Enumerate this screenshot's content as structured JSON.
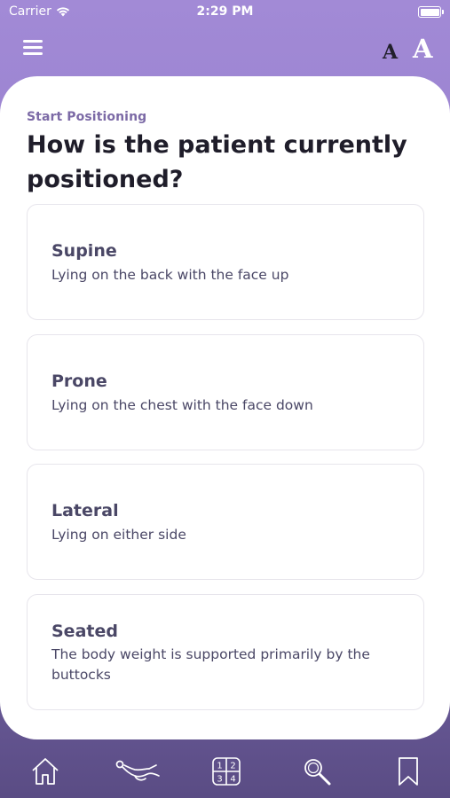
{
  "status_bar": {
    "carrier": "Carrier",
    "time": "2:29 PM"
  },
  "header": {
    "menu_icon": "hamburger-icon",
    "font_small_label": "A",
    "font_large_label": "A"
  },
  "main": {
    "eyebrow": "Start Positioning",
    "question": "How is the patient currently positioned?",
    "options": [
      {
        "title": "Supine",
        "description": "Lying on the back with the face up"
      },
      {
        "title": "Prone",
        "description": "Lying on the chest with the face down"
      },
      {
        "title": "Lateral",
        "description": "Lying on either side"
      },
      {
        "title": "Seated",
        "description": "The body weight is supported primarily by the buttocks"
      }
    ]
  },
  "tabbar": {
    "tabs": [
      {
        "icon": "home-icon"
      },
      {
        "icon": "patient-position-icon"
      },
      {
        "icon": "grid-numbers-icon",
        "digits": [
          "1",
          "2",
          "3",
          "4"
        ]
      },
      {
        "icon": "search-icon"
      },
      {
        "icon": "bookmark-icon"
      }
    ]
  },
  "colors": {
    "header_purple": "#a28ad6",
    "card_bg": "#ffffff",
    "eyebrow": "#7c6aa6",
    "title_text": "#1f1d2a",
    "option_text": "#4a4766",
    "tab_icon": "#ffffff"
  }
}
